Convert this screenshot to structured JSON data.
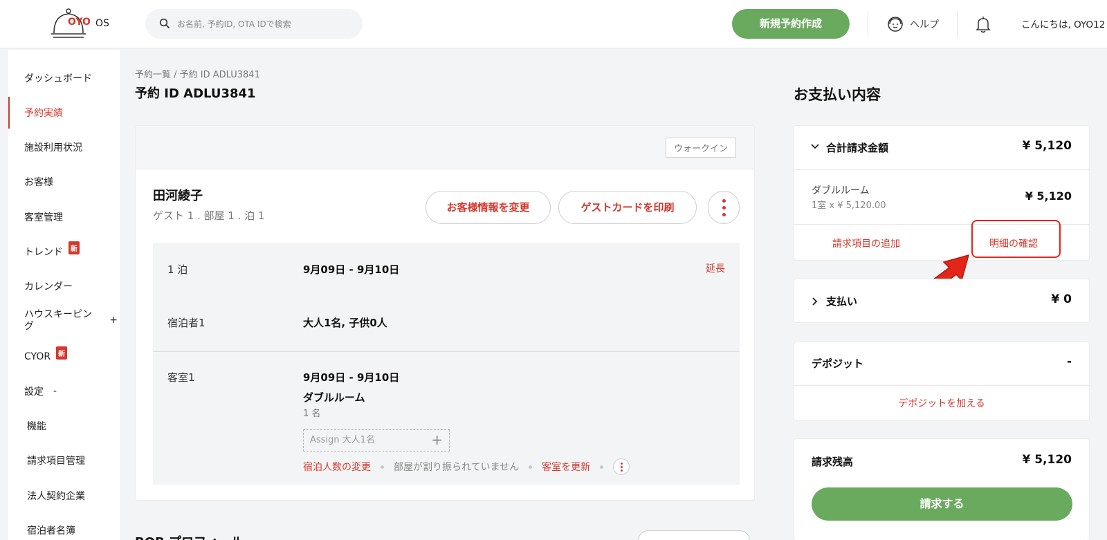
{
  "header": {
    "logo_brand": "OYO",
    "logo_suffix": "OS",
    "search_placeholder": "お名前, 予約ID, OTA IDで検索",
    "new_booking_label": "新規予約作成",
    "help_label": "ヘルプ",
    "greeting": "こんにちは, OYO12"
  },
  "sidebar": {
    "items": [
      {
        "label": "ダッシュボード"
      },
      {
        "label": "予約実績",
        "active": true
      },
      {
        "label": "施設利用状況"
      },
      {
        "label": "お客様"
      },
      {
        "label": "客室管理"
      },
      {
        "label": "トレンド",
        "badge": "新"
      },
      {
        "label": "カレンダー"
      },
      {
        "label": "ハウスキーピン\nグ",
        "toggle": "+"
      },
      {
        "label": "CYOR",
        "badge": "新"
      },
      {
        "label": "設定",
        "toggle": "-"
      },
      {
        "label": "機能"
      },
      {
        "label": "請求項目管理"
      },
      {
        "label": "法人契約企業"
      },
      {
        "label": "宿泊者名簿"
      }
    ]
  },
  "main": {
    "breadcrumb": "予約一覧 / 予約 ID ADLU3841",
    "title": "予約 ID ADLU3841",
    "walkin_tag": "ウォークイン",
    "guest_name": "田河綾子",
    "guest_summary": "ゲスト 1 . 部屋 1 . 泊 1",
    "change_info_label": "お客様情報を変更",
    "print_card_label": "ゲストカードを印刷",
    "stay": {
      "nights_label": "1 泊",
      "dates": "9月09日 - 9月10日",
      "extend_label": "延長",
      "occupants_label": "宿泊者1",
      "occupants_value": "大人1名, 子供0人"
    },
    "room": {
      "label": "客室1",
      "dates": "9月09日 - 9月10日",
      "type": "ダブルルーム",
      "count": "1 名",
      "assign_placeholder": "Assign 大人1名",
      "change_guests_label": "宿泊人数の変更",
      "unassigned_text": "部屋が割り振られていません",
      "update_room_label": "客室を更新"
    },
    "next_section_title": "BOB プロフィール"
  },
  "payment": {
    "title": "お支払い内容",
    "total_label": "合計請求金額",
    "total_value": "¥ 5,120",
    "item_name": "ダブルルーム",
    "item_detail": "1室 x ¥ 5,120.00",
    "item_value": "¥ 5,120",
    "add_item_label": "請求項目の追加",
    "view_details_label": "明細の確認",
    "payments_label": "支払い",
    "payments_value": "¥ 0",
    "deposit_label": "デポジット",
    "deposit_value": "-",
    "add_deposit_label": "デポジットを加える",
    "balance_label": "請求残高",
    "balance_value": "¥ 5,120",
    "charge_label": "請求する"
  },
  "colors": {
    "accent_red": "#d4382c",
    "primary_green": "#6aaa5e",
    "annotation_red": "#e3251a"
  }
}
